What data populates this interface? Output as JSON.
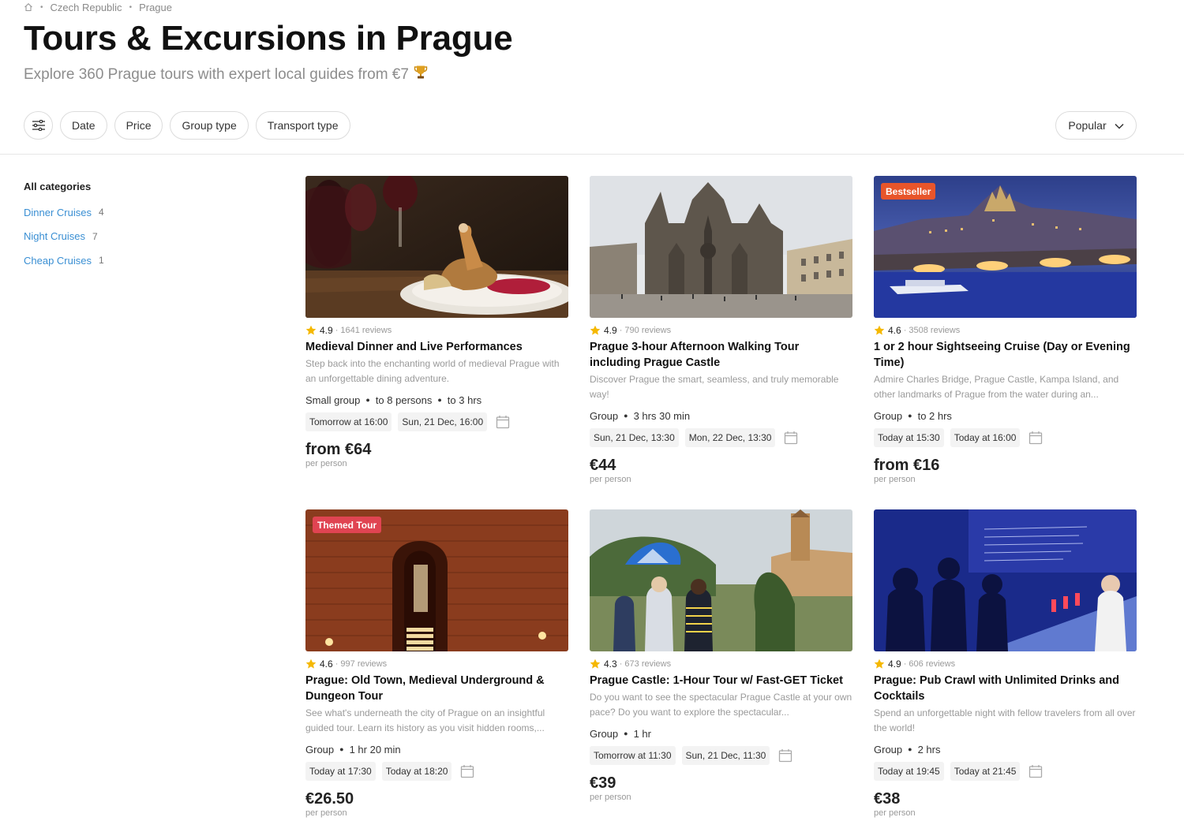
{
  "breadcrumb": {
    "home_icon": "home-icon",
    "items": [
      "Czech Republic",
      "Prague"
    ]
  },
  "header": {
    "title": "Tours & Excursions in Prague",
    "subtitle": "Explore 360 Prague tours with expert local guides from €7",
    "subtitle_icon": "trophy-icon"
  },
  "filters": {
    "settings_icon": "filter-sliders-icon",
    "chips": [
      "Date",
      "Price",
      "Group type",
      "Transport type"
    ],
    "sort_label": "Popular",
    "sort_icon": "chevron-down-icon"
  },
  "sidebar": {
    "heading": "All categories",
    "categories": [
      {
        "name": "Dinner Cruises",
        "count": "4"
      },
      {
        "name": "Night Cruises",
        "count": "7"
      },
      {
        "name": "Cheap Cruises",
        "count": "1"
      }
    ]
  },
  "colors": {
    "link": "#3a8fd3",
    "bestseller_badge": "#e8552a",
    "themed_badge": "#e04452",
    "star": "#f5b800"
  },
  "tours": [
    {
      "badge": "",
      "rating": "4.9",
      "reviews": "· 1641 reviews",
      "title": "Medieval Dinner and Live Performances",
      "description": "Step back into the enchanting world of medieval Prague with an unforgettable dining adventure.",
      "meta": [
        "Small group",
        "to 8 persons",
        "to 3 hrs"
      ],
      "times": [
        "Tomorrow at 16:00",
        "Sun, 21 Dec, 16:00"
      ],
      "price": "from €64",
      "price_note": "per person",
      "image": "medieval-dinner-photo"
    },
    {
      "badge": "",
      "rating": "4.9",
      "reviews": "· 790 reviews",
      "title": "Prague 3-hour Afternoon Walking Tour including Prague Castle",
      "description": "Discover Prague the smart, seamless, and truly memorable way!",
      "meta": [
        "Group",
        "3 hrs 30 min"
      ],
      "times": [
        "Sun, 21 Dec, 13:30",
        "Mon, 22 Dec, 13:30"
      ],
      "price": "€44",
      "price_note": "per person",
      "image": "prague-castle-cathedral-photo"
    },
    {
      "badge": "Bestseller",
      "rating": "4.6",
      "reviews": "· 3508 reviews",
      "title": "1 or 2 hour Sightseeing Cruise (Day or Evening Time)",
      "description": "Admire Charles Bridge, Prague Castle, Kampa Island, and other landmarks of Prague from the water during an...",
      "meta": [
        "Group",
        "to 2 hrs"
      ],
      "times": [
        "Today at 15:30",
        "Today at 16:00"
      ],
      "price": "from €16",
      "price_note": "per person",
      "image": "charles-bridge-night-photo"
    },
    {
      "badge": "Themed Tour",
      "rating": "4.6",
      "reviews": "· 997 reviews",
      "title": "Prague: Old Town, Medieval Underground & Dungeon Tour",
      "description": "See what's underneath the city of Prague on an insightful guided tour. Learn its history as you visit hidden rooms,...",
      "meta": [
        "Group",
        "1 hr 20 min"
      ],
      "times": [
        "Today at 17:30",
        "Today at 18:20"
      ],
      "price": "€26.50",
      "price_note": "per person",
      "image": "underground-cellar-photo"
    },
    {
      "badge": "",
      "rating": "4.3",
      "reviews": "· 673 reviews",
      "title": "Prague Castle: 1-Hour Tour w/ Fast-GET Ticket",
      "description": "Do you want to see the spectacular Prague Castle at your own pace? Do you want to explore the spectacular...",
      "meta": [
        "Group",
        "1 hr"
      ],
      "times": [
        "Tomorrow at 11:30",
        "Sun, 21 Dec, 11:30"
      ],
      "price": "€39",
      "price_note": "per person",
      "image": "castle-tour-group-photo"
    },
    {
      "badge": "",
      "rating": "4.9",
      "reviews": "· 606 reviews",
      "title": "Prague: Pub Crawl with Unlimited Drinks and Cocktails",
      "description": "Spend an unforgettable night with fellow travelers from all over the world!",
      "meta": [
        "Group",
        "2 hrs"
      ],
      "times": [
        "Today at 19:45",
        "Today at 21:45"
      ],
      "price": "€38",
      "price_note": "per person",
      "image": "pub-crawl-bar-photo"
    }
  ]
}
